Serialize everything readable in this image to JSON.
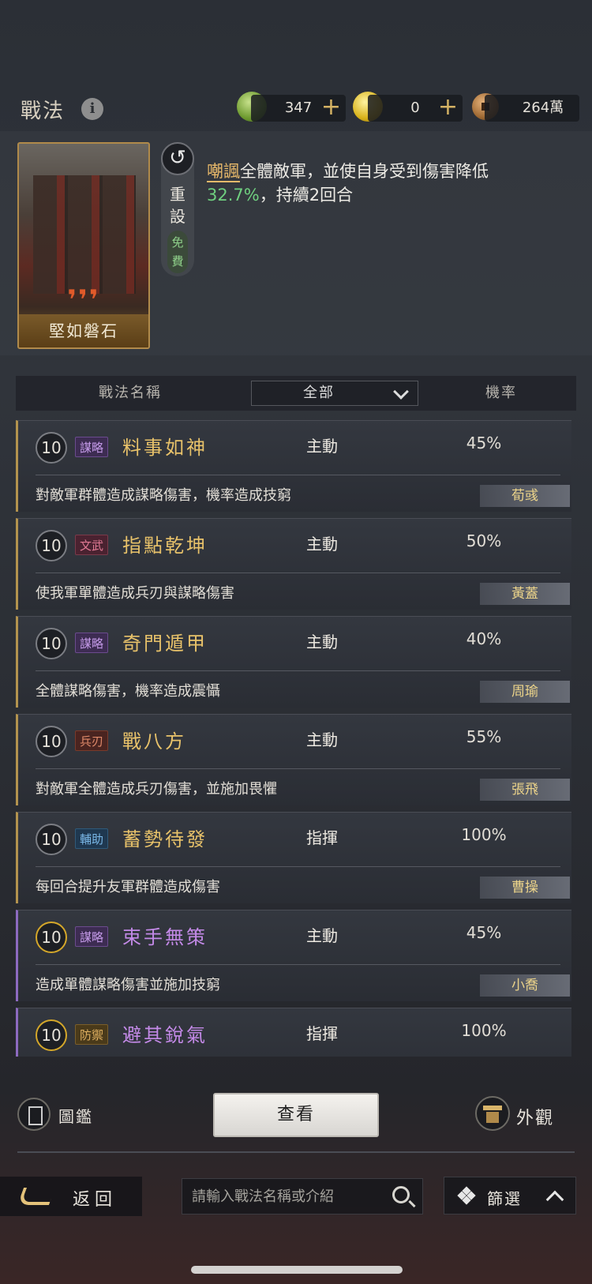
{
  "header": {
    "title": "戰法",
    "resources": [
      {
        "icon": "jade-coin-icon",
        "value": "347",
        "has_plus": true
      },
      {
        "icon": "gold-coin-icon",
        "value": "0",
        "has_plus": true
      },
      {
        "icon": "copper-coin-icon",
        "value": "264萬",
        "has_plus": false
      }
    ],
    "plus": "+"
  },
  "selected": {
    "card_name": "堅如磐石",
    "card_quotes": "❜❜❜",
    "reset_label": "重\n設",
    "free_label": "免\n費",
    "desc_keyword": "嘲諷",
    "desc_part1": "全體敵軍，並使自身受到傷害降低",
    "desc_num": "32.7%",
    "desc_part2": "，持續2回合"
  },
  "list_header": {
    "name_col": "戰法名稱",
    "filter_value": "全部",
    "rate_col": "機率"
  },
  "tactics": [
    {
      "level": "10",
      "tag": "謀略",
      "tag_kind": "strat",
      "name": "料事如神",
      "type": "主動",
      "rate": "45%",
      "desc": "對敵軍群體造成謀略傷害，機率造成技窮",
      "general": "荀彧",
      "quality": "gold"
    },
    {
      "level": "10",
      "tag": "文武",
      "tag_kind": "civ",
      "name": "指點乾坤",
      "type": "主動",
      "rate": "50%",
      "desc": "使我軍單體造成兵刃與謀略傷害",
      "general": "黃蓋",
      "quality": "gold"
    },
    {
      "level": "10",
      "tag": "謀略",
      "tag_kind": "strat",
      "name": "奇門遁甲",
      "type": "主動",
      "rate": "40%",
      "desc": "全體謀略傷害，機率造成震懾",
      "general": "周瑜",
      "quality": "gold"
    },
    {
      "level": "10",
      "tag": "兵刃",
      "tag_kind": "blade",
      "name": "戰八方",
      "type": "主動",
      "rate": "55%",
      "desc": "對敵軍全體造成兵刃傷害，並施加畏懼",
      "general": "張飛",
      "quality": "gold"
    },
    {
      "level": "10",
      "tag": "輔助",
      "tag_kind": "assist",
      "name": "蓄勢待發",
      "type": "指揮",
      "rate": "100%",
      "desc": "每回合提升友軍群體造成傷害",
      "general": "曹操",
      "quality": "gold"
    },
    {
      "level": "10",
      "tag": "謀略",
      "tag_kind": "strat",
      "name": "束手無策",
      "type": "主動",
      "rate": "45%",
      "desc": "造成單體謀略傷害並施加技窮",
      "general": "小喬",
      "quality": "purple"
    },
    {
      "level": "10",
      "tag": "防禦",
      "tag_kind": "def",
      "name": "避其銳氣",
      "type": "指揮",
      "rate": "100%",
      "desc": "",
      "general": "",
      "quality": "purple"
    }
  ],
  "bottom": {
    "atlas_label": "圖鑑",
    "view_label": "查看",
    "looks_label": "外觀",
    "back_label": "返回",
    "search_placeholder": "請輸入戰法名稱或介紹",
    "filter_label": "篩選"
  }
}
